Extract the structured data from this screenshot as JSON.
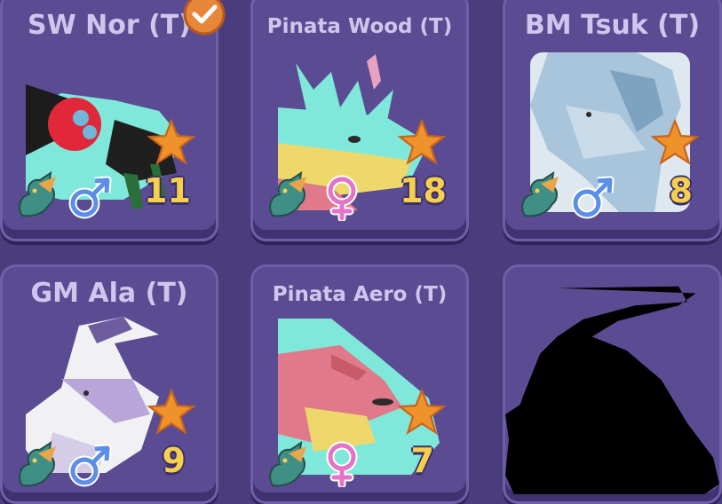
{
  "cards": [
    {
      "title": "SW Nor (T)",
      "level": "11",
      "gender": "male",
      "gender_icon": "male-symbol-icon",
      "species_icon": "dragon-species-icon",
      "star_icon": "star-icon",
      "selected": true
    },
    {
      "title": "Pinata Wood (T)",
      "level": "18",
      "gender": "female",
      "gender_icon": "female-symbol-icon",
      "species_icon": "dragon-species-icon",
      "star_icon": "star-icon"
    },
    {
      "title": "BM Tsuk (T)",
      "level": "8",
      "gender": "male",
      "gender_icon": "male-symbol-icon",
      "species_icon": "dragon-species-icon",
      "star_icon": "star-icon"
    },
    {
      "title": "GM Ala (T)",
      "level": "9",
      "gender": "male",
      "gender_icon": "male-symbol-icon",
      "species_icon": "dragon-species-icon",
      "star_icon": "star-icon"
    },
    {
      "title": "Pinata Aero (T)",
      "level": "7",
      "gender": "female",
      "gender_icon": "female-symbol-icon",
      "species_icon": "dragon-species-icon",
      "star_icon": "star-icon"
    },
    {
      "redacted": true
    }
  ],
  "colors": {
    "background": "#4a3d7e",
    "card": "#5a4b92",
    "title": "#cfc6ee",
    "level": "#f6d04d",
    "star": "#f0922c",
    "male": "#5b8fe6",
    "female": "#e474c8",
    "check_badge": "#e8863a"
  }
}
